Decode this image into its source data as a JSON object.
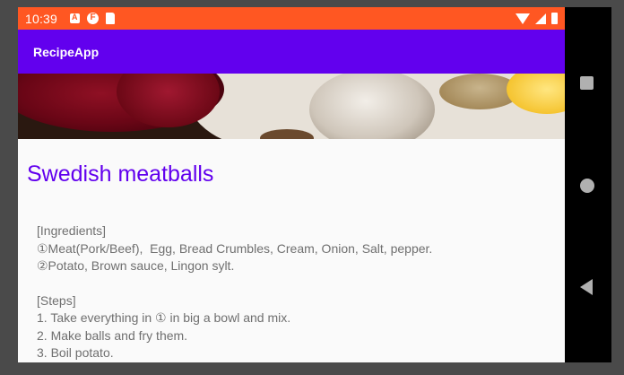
{
  "status_bar": {
    "time": "10:39",
    "background": "#ff5722",
    "left_icons": [
      "a-badge-icon",
      "f-badge-icon",
      "sd-card-icon"
    ],
    "right_icons": [
      "wifi-icon",
      "signal-icon",
      "battery-icon"
    ]
  },
  "app_bar": {
    "title": "RecipeApp",
    "background": "#6200ee"
  },
  "recipe": {
    "title": "Swedish meatballs",
    "ingredients_header": "[Ingredients]",
    "ingredients": [
      "①Meat(Pork/Beef),  Egg, Bread Crumbles, Cream, Onion, Salt, pepper.",
      "②Potato, Brown sauce, Lingon sylt."
    ],
    "steps_header": "[Steps]",
    "steps": [
      "1. Take everything in ① in big a bowl and mix.",
      "2. Make balls and fry them.",
      "3. Boil potato."
    ]
  },
  "device_nav": {
    "buttons": [
      "overview-button",
      "home-button",
      "back-button"
    ]
  }
}
